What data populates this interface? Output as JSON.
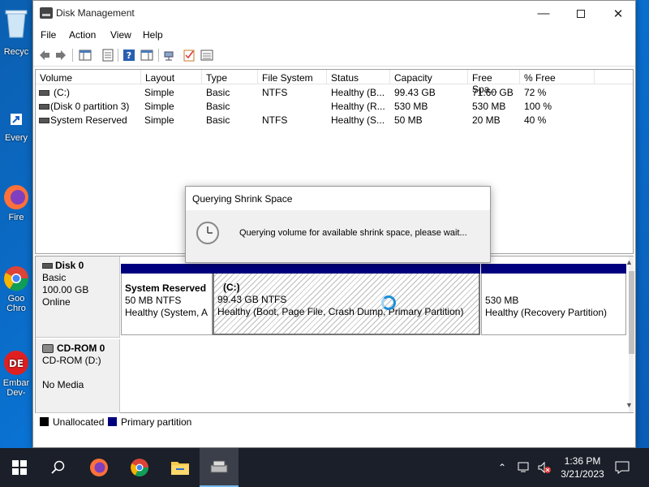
{
  "desktop": {
    "icons": [
      {
        "label": "Recyc"
      },
      {
        "label": "Every"
      },
      {
        "label": "Fire"
      },
      {
        "label": "Goo",
        "label2": "Chro"
      },
      {
        "label": "Embar",
        "label2": "Dev-"
      }
    ]
  },
  "window": {
    "title": "Disk Management",
    "menu": [
      "File",
      "Action",
      "View",
      "Help"
    ]
  },
  "list": {
    "columns": [
      "Volume",
      "Layout",
      "Type",
      "File System",
      "Status",
      "Capacity",
      "Free Spa...",
      "% Free"
    ],
    "rows": [
      {
        "volume": "(C:)",
        "layout": "Simple",
        "type": "Basic",
        "fs": "NTFS",
        "status": "Healthy (B...",
        "capacity": "99.43 GB",
        "free": "71.60 GB",
        "pct": "72 %"
      },
      {
        "volume": "(Disk 0 partition 3)",
        "layout": "Simple",
        "type": "Basic",
        "fs": "",
        "status": "Healthy (R...",
        "capacity": "530 MB",
        "free": "530 MB",
        "pct": "100 %"
      },
      {
        "volume": "System Reserved",
        "layout": "Simple",
        "type": "Basic",
        "fs": "NTFS",
        "status": "Healthy (S...",
        "capacity": "50 MB",
        "free": "20 MB",
        "pct": "40 %"
      }
    ]
  },
  "disks": {
    "disk0": {
      "name": "Disk 0",
      "type": "Basic",
      "size": "100.00 GB",
      "state": "Online",
      "parts": [
        {
          "name": "System Reserved",
          "size": "50 MB NTFS",
          "status": "Healthy (System, A"
        },
        {
          "name": "(C:)",
          "size": "99.43 GB NTFS",
          "status": "Healthy (Boot, Page File, Crash Dump, Primary Partition)"
        },
        {
          "name": "",
          "size": "530 MB",
          "status": "Healthy (Recovery Partition)"
        }
      ]
    },
    "cdrom": {
      "name": "CD-ROM 0",
      "drive": "CD-ROM (D:)",
      "media": "No Media"
    }
  },
  "legend": {
    "unallocated": "Unallocated",
    "primary": "Primary partition",
    "unalloc_color": "#000000",
    "primary_color": "#00007f"
  },
  "dialog": {
    "title": "Querying Shrink Space",
    "message": "Querying volume for available shrink space, please wait..."
  },
  "taskbar": {
    "time": "1:36 PM",
    "date": "3/21/2023"
  }
}
